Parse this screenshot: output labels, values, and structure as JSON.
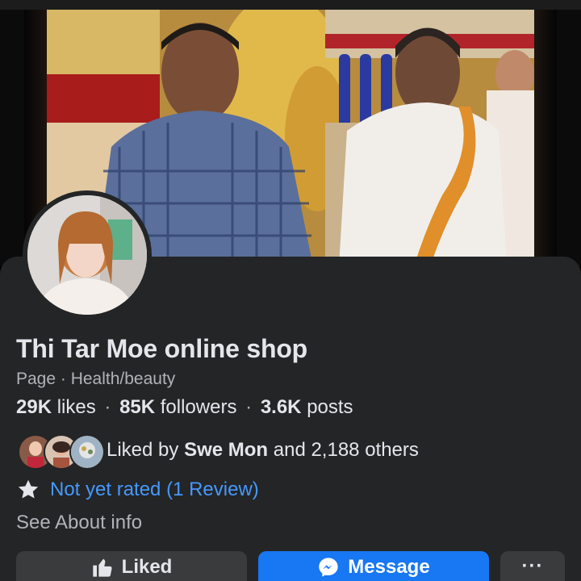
{
  "profile": {
    "name": "Thi Tar Moe online shop",
    "subtitle": "Page · Health/beauty",
    "stats": {
      "likes_value": "29K",
      "likes_label": "likes",
      "followers_value": "85K",
      "followers_label": "followers",
      "posts_value": "3.6K",
      "posts_label": "posts",
      "separator": "·"
    },
    "liked_by": {
      "prefix": "Liked by",
      "friend": "Swe Mon",
      "suffix": "and 2,188 others"
    },
    "rating_text": "Not yet rated (1 Review)",
    "about_link": "See About info"
  },
  "actions": {
    "liked_label": "Liked",
    "message_label": "Message",
    "more_label": "···"
  },
  "icons": {
    "liked": "thumbs-up-icon",
    "message": "messenger-icon",
    "rating": "star-icon"
  },
  "colors": {
    "background": "#242526",
    "link": "#4599ff",
    "primary_button": "#1877f2",
    "secondary_button": "#3a3b3c",
    "text_primary": "#e4e6eb",
    "text_secondary": "#b0b3b8"
  }
}
